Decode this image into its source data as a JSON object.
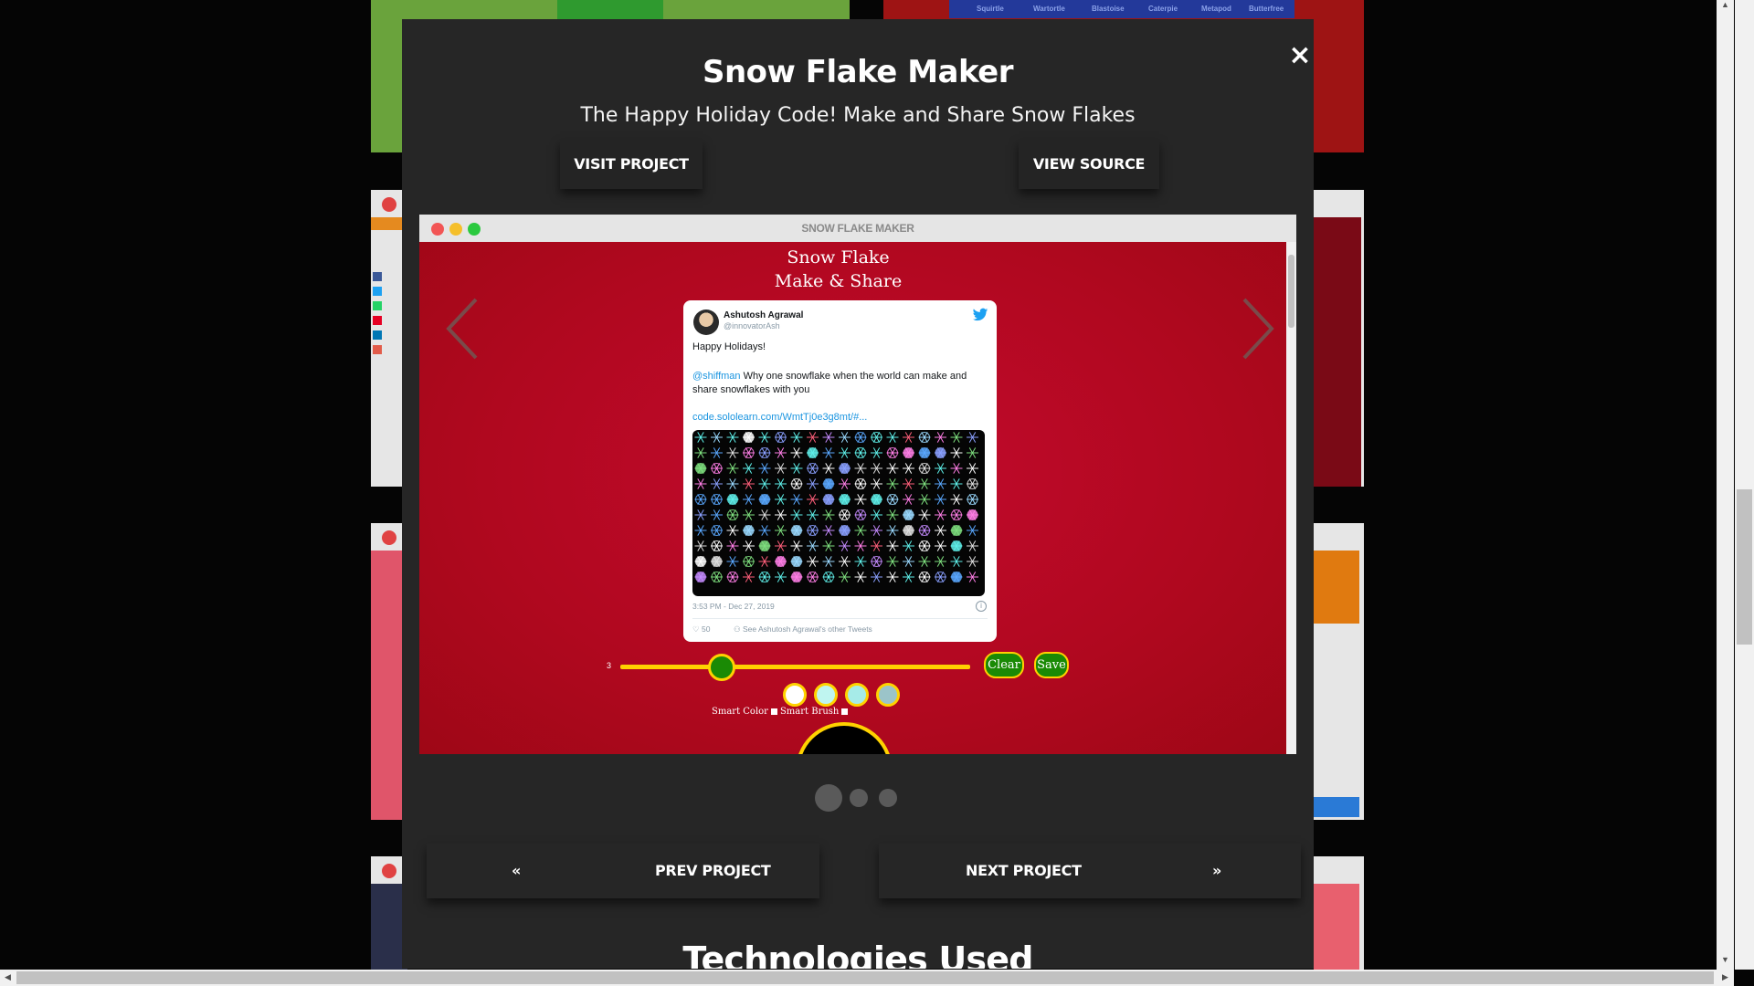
{
  "background_cards": [
    {
      "tabs": [
        "Squirtle",
        "Wartortle",
        "Blastoise",
        "Caterpie",
        "Metapod",
        "Butterfree"
      ]
    }
  ],
  "modal": {
    "title": "Snow Flake Maker",
    "subtitle": "The Happy Holiday Code! Make and Share Snow Flakes",
    "close_label": "×",
    "visit_label": "VISIT PROJECT",
    "source_label": "VIEW SOURCE",
    "browser_title": "SNOW FLAKE MAKER",
    "app": {
      "title_line1": "Snow Flake",
      "title_line2": "Make & Share",
      "tweet": {
        "author": "Ashutosh Agrawal",
        "handle": "@innovatorAsh",
        "line1": "Happy Holidays!",
        "mention": "@shiffman",
        "body": " Why one snowflake when the world can make and share snowflakes with you",
        "link": "code.sololearn.com/WmtTj0e3g8mt/#...",
        "timestamp": "3:53 PM - Dec 27, 2019",
        "likes": "50",
        "other_tweets": "See Ashutosh Agrawal's other Tweets"
      },
      "slider_value": "3",
      "slider_fraction": 0.29,
      "clear_label": "Clear",
      "save_label": "Save",
      "swatches": [
        "#ffffff",
        "#bff5f0",
        "#a6ebe8",
        "#9bc4c9"
      ],
      "smart_color_label": "Smart Color",
      "smart_brush_label": "Smart Brush"
    },
    "slides": {
      "count": 3,
      "active": 0
    },
    "prev_label": "PREV PROJECT",
    "next_label": "NEXT PROJECT",
    "prev_icon": "«",
    "next_icon": "»",
    "technologies_heading": "Technologies Used"
  },
  "colors": {
    "modal_bg": "#262626",
    "app_red": "#b30a26",
    "accent_yellow": "#ffd200",
    "button_green": "#1a8a05"
  }
}
